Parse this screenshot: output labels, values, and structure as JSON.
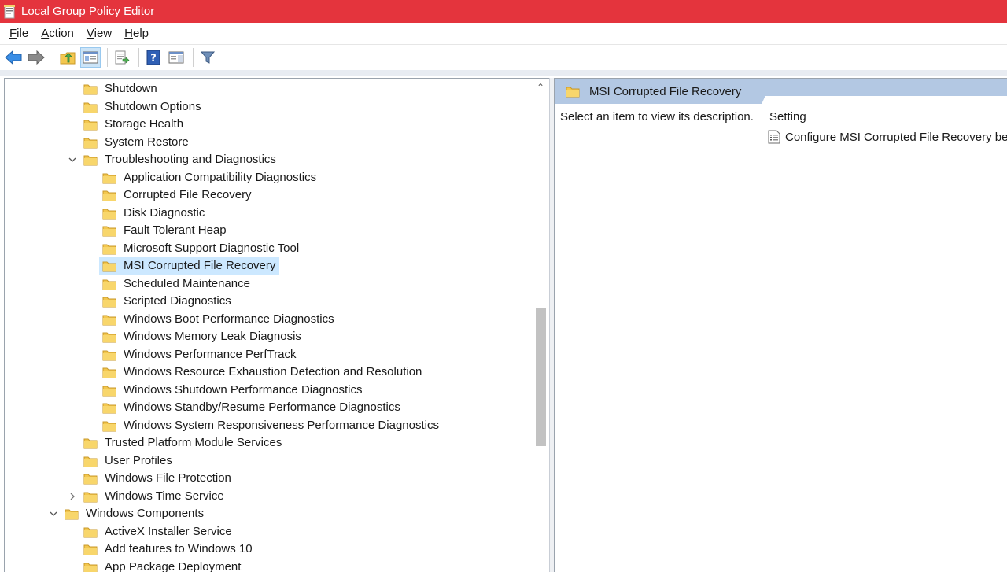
{
  "window": {
    "title": "Local Group Policy Editor"
  },
  "menu": [
    {
      "underline": "F",
      "rest": "ile"
    },
    {
      "underline": "A",
      "rest": "ction"
    },
    {
      "underline": "V",
      "rest": "iew"
    },
    {
      "underline": "H",
      "rest": "elp"
    }
  ],
  "tree": [
    {
      "label": "Shutdown",
      "depth": 2
    },
    {
      "label": "Shutdown Options",
      "depth": 2
    },
    {
      "label": "Storage Health",
      "depth": 2
    },
    {
      "label": "System Restore",
      "depth": 2
    },
    {
      "label": "Troubleshooting and Diagnostics",
      "depth": 2,
      "expander": "expanded"
    },
    {
      "label": "Application Compatibility Diagnostics",
      "depth": 3
    },
    {
      "label": "Corrupted File Recovery",
      "depth": 3
    },
    {
      "label": "Disk Diagnostic",
      "depth": 3
    },
    {
      "label": "Fault Tolerant Heap",
      "depth": 3
    },
    {
      "label": "Microsoft Support Diagnostic Tool",
      "depth": 3
    },
    {
      "label": "MSI Corrupted File Recovery",
      "depth": 3,
      "selected": true
    },
    {
      "label": "Scheduled Maintenance",
      "depth": 3
    },
    {
      "label": "Scripted Diagnostics",
      "depth": 3
    },
    {
      "label": "Windows Boot Performance Diagnostics",
      "depth": 3
    },
    {
      "label": "Windows Memory Leak Diagnosis",
      "depth": 3
    },
    {
      "label": "Windows Performance PerfTrack",
      "depth": 3
    },
    {
      "label": "Windows Resource Exhaustion Detection and Resolution",
      "depth": 3
    },
    {
      "label": "Windows Shutdown Performance Diagnostics",
      "depth": 3
    },
    {
      "label": "Windows Standby/Resume Performance Diagnostics",
      "depth": 3
    },
    {
      "label": "Windows System Responsiveness Performance Diagnostics",
      "depth": 3
    },
    {
      "label": "Trusted Platform Module Services",
      "depth": 2
    },
    {
      "label": "User Profiles",
      "depth": 2
    },
    {
      "label": "Windows File Protection",
      "depth": 2
    },
    {
      "label": "Windows Time Service",
      "depth": 2,
      "expander": "collapsed"
    },
    {
      "label": "Windows Components",
      "depth": 1,
      "expander": "expanded"
    },
    {
      "label": "ActiveX Installer Service",
      "depth": 2
    },
    {
      "label": "Add features to Windows 10",
      "depth": 2
    },
    {
      "label": "App Package Deployment",
      "depth": 2
    }
  ],
  "right_pane": {
    "title": "MSI Corrupted File Recovery",
    "description": "Select an item to view its description.",
    "column_header": "Setting",
    "settings": [
      {
        "label": "Configure MSI Corrupted File Recovery beha"
      }
    ]
  },
  "colors": {
    "titlebar": "#e4343d",
    "selection": "#cce8ff",
    "header_tab": "#b3c8e3",
    "folder": "#f3c74f"
  }
}
